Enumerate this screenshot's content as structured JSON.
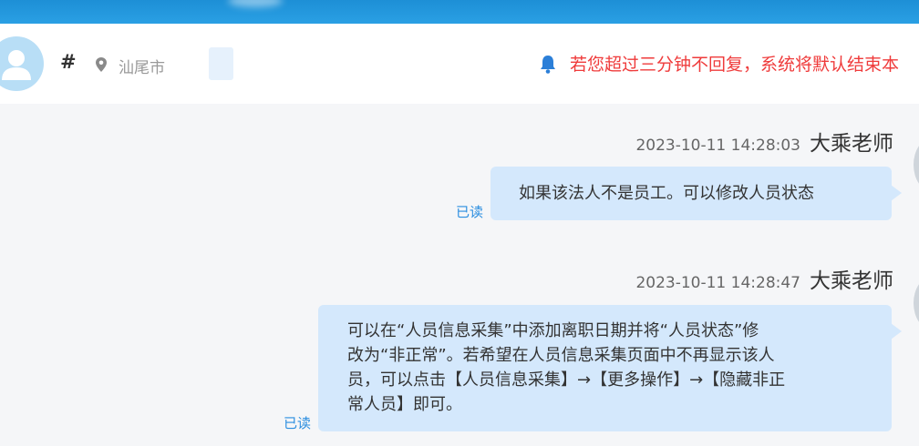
{
  "header": {
    "hash": "#",
    "location": "汕尾市",
    "notice": "若您超过三分钟不回复，系统将默认结束本"
  },
  "messages": [
    {
      "time": "2023-10-11 14:28:03",
      "sender": "大乘老师",
      "text": "如果该法人不是员工。可以修改人员状态",
      "status": "已读"
    },
    {
      "time": "2023-10-11 14:28:47",
      "sender": "大乘老师",
      "lines": [
        "可以在“人员信息采集”中添加离职日期并将“人员状态”修",
        "改为“非正常”。若希望在人员信息采集页面中不再显示该人",
        "员，可以点击【人员信息采集】→【更多操作】→【隐藏非正",
        "常人员】即可。"
      ],
      "status": "已读"
    }
  ],
  "colors": {
    "banner": "#2aa0e4",
    "bubble": "#d4e8fc",
    "notice": "#ef3b3b",
    "read": "#2b8ee0"
  }
}
